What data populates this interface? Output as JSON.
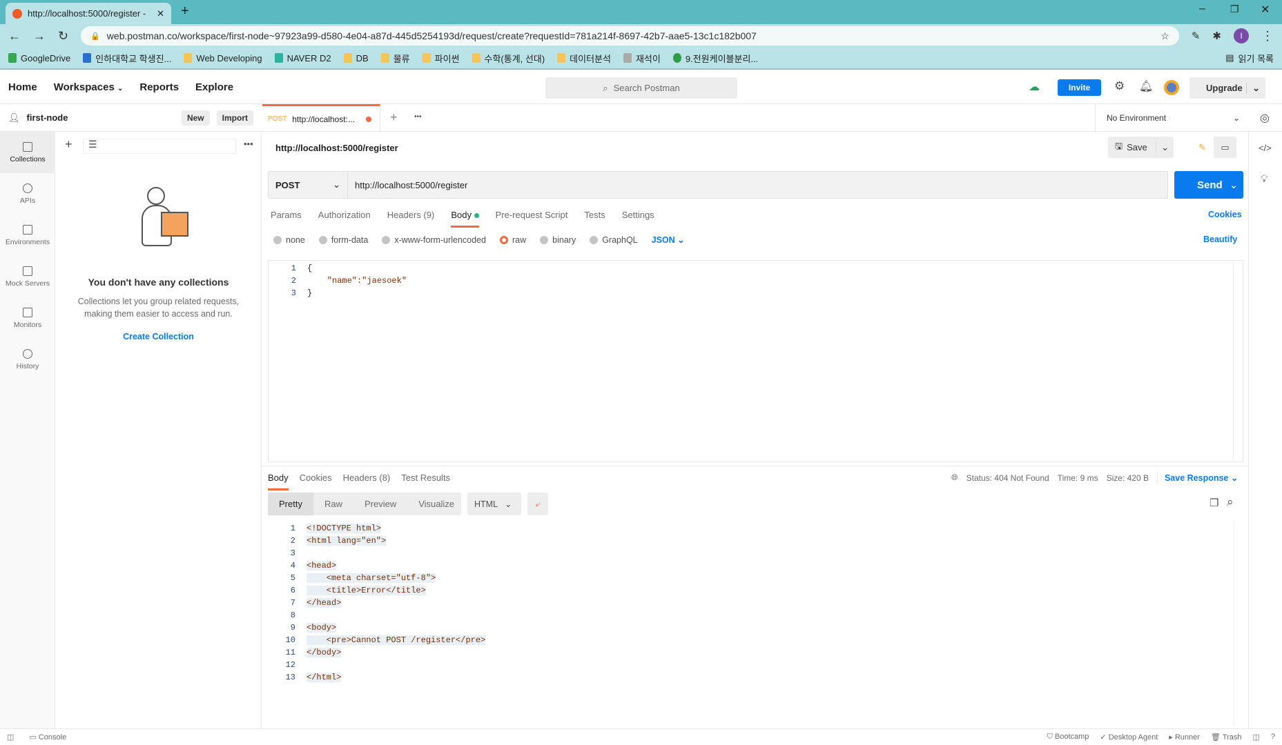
{
  "browser": {
    "tab_title": "http://localhost:5000/register - ",
    "address": "web.postman.co/workspace/first-node~97923a99-d580-4e04-a87d-445d5254193d/request/create?requestId=781a214f-8697-42b7-aae5-13c1c182b007",
    "bookmarks": [
      "GoogleDrive",
      "인하대학교 학생진...",
      "Web Developing",
      "NAVER D2",
      "DB",
      "물류",
      "파이썬",
      "수학(통계, 선대)",
      "데이터분석",
      "재석이",
      "9.전원케이블분리..."
    ],
    "reading_list": "읽기 목록",
    "profile_initial": "I"
  },
  "header": {
    "nav": [
      "Home",
      "Workspaces",
      "Reports",
      "Explore"
    ],
    "search_placeholder": "Search Postman",
    "invite": "Invite",
    "upgrade": "Upgrade"
  },
  "sidebar": {
    "workspace": "first-node",
    "new": "New",
    "import": "Import",
    "items": [
      "Collections",
      "APIs",
      "Environments",
      "Mock Servers",
      "Monitors",
      "History"
    ],
    "empty_title": "You don't have any collections",
    "empty_text_1": "Collections let you group related requests,",
    "empty_text_2": "making them easier to access and run.",
    "create": "Create Collection"
  },
  "request_tab": {
    "method": "POST",
    "title": "http://localhost:..."
  },
  "environment": "No Environment",
  "request": {
    "name": "http://localhost:5000/register",
    "save": "Save",
    "method": "POST",
    "url": "http://localhost:5000/register",
    "send": "Send",
    "tabs": [
      "Params",
      "Authorization",
      "Headers (9)",
      "Body",
      "Pre-request Script",
      "Tests",
      "Settings"
    ],
    "cookies": "Cookies",
    "body_types": [
      "none",
      "form-data",
      "x-www-form-urlencoded",
      "raw",
      "binary",
      "GraphQL"
    ],
    "format": "JSON",
    "beautify": "Beautify",
    "body_lines": [
      "{",
      "    \"name\":\"jaesoek\"",
      "}"
    ]
  },
  "response": {
    "tabs": [
      "Body",
      "Cookies",
      "Headers (8)",
      "Test Results"
    ],
    "status": "Status: 404 Not Found",
    "time": "Time: 9 ms",
    "size": "Size: 420 B",
    "save": "Save Response",
    "views": [
      "Pretty",
      "Raw",
      "Preview",
      "Visualize"
    ],
    "format": "HTML",
    "lines": [
      "<!DOCTYPE html>",
      "<html lang=\"en\">",
      "",
      "<head>",
      "    <meta charset=\"utf-8\">",
      "    <title>Error</title>",
      "</head>",
      "",
      "<body>",
      "    <pre>Cannot POST /register</pre>",
      "</body>",
      "",
      "</html>"
    ]
  },
  "footer": {
    "console": "Console",
    "bootcamp": "Bootcamp",
    "agent": "Desktop Agent",
    "runner": "Runner",
    "trash": "Trash"
  }
}
